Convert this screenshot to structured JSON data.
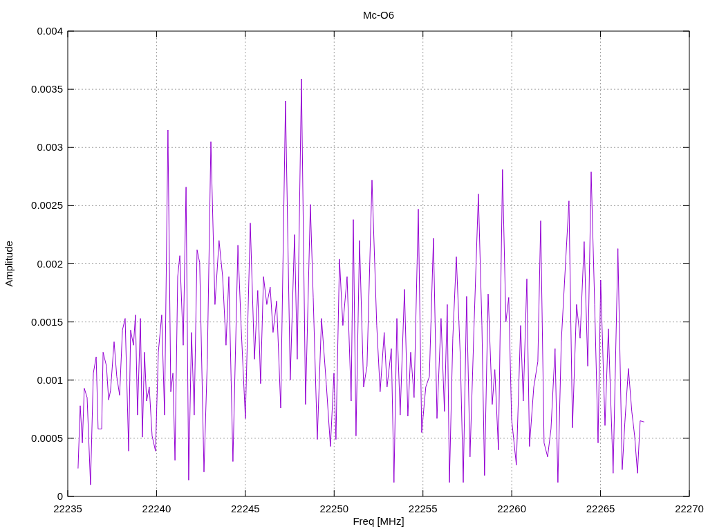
{
  "chart_data": {
    "type": "line",
    "grid": true,
    "title": "Mc-O6",
    "xlabel": "Freq [MHz]",
    "ylabel": "Amplitude",
    "xlim": [
      22235,
      22270
    ],
    "ylim": [
      0,
      0.004
    ],
    "xticks": [
      22235,
      22240,
      22245,
      22250,
      22255,
      22260,
      22265,
      22270
    ],
    "yticks": [
      0,
      0.0005,
      0.001,
      0.0015,
      0.002,
      0.0025,
      0.003,
      0.0035,
      0.004
    ],
    "x": [
      22235.58,
      22235.7,
      22235.82,
      22235.93,
      22236.09,
      22236.28,
      22236.44,
      22236.6,
      22236.71,
      22236.91,
      22236.99,
      22237.18,
      22237.3,
      22237.41,
      22237.61,
      22237.76,
      22237.92,
      22238.08,
      22238.23,
      22238.43,
      22238.54,
      22238.7,
      22238.81,
      22238.93,
      22239.09,
      22239.2,
      22239.32,
      22239.44,
      22239.59,
      22239.75,
      22239.94,
      22240.1,
      22240.29,
      22240.45,
      22240.64,
      22240.8,
      22240.92,
      22241.04,
      22241.19,
      22241.31,
      22241.5,
      22241.66,
      22241.81,
      22241.97,
      22242.12,
      22242.28,
      22242.43,
      22242.67,
      22242.86,
      22243.06,
      22243.29,
      22243.52,
      22243.72,
      22243.91,
      22244.07,
      22244.3,
      22244.58,
      22244.77,
      22245.0,
      22245.28,
      22245.51,
      22245.7,
      22245.86,
      22246.02,
      22246.21,
      22246.4,
      22246.56,
      22246.76,
      22246.99,
      22247.26,
      22247.53,
      22247.77,
      22247.92,
      22248.16,
      22248.39,
      22248.66,
      22248.82,
      22249.05,
      22249.29,
      22249.56,
      22249.79,
      22249.99,
      22250.1,
      22250.3,
      22250.49,
      22250.73,
      22250.96,
      22251.08,
      22251.23,
      22251.43,
      22251.66,
      22251.85,
      22252.13,
      22252.4,
      22252.59,
      22252.82,
      22252.98,
      22253.22,
      22253.37,
      22253.53,
      22253.72,
      22253.96,
      22254.15,
      22254.31,
      22254.5,
      22254.74,
      22254.93,
      22255.16,
      22255.36,
      22255.59,
      22255.79,
      22256.02,
      22256.21,
      22256.37,
      22256.49,
      22256.68,
      22256.88,
      22257.11,
      22257.27,
      22257.46,
      22257.65,
      22257.89,
      22258.12,
      22258.32,
      22258.47,
      22258.67,
      22258.9,
      22259.05,
      22259.25,
      22259.48,
      22259.67,
      22259.83,
      22259.99,
      22260.26,
      22260.5,
      22260.65,
      22260.85,
      22261.0,
      22261.24,
      22261.47,
      22261.63,
      22261.82,
      22262.02,
      22262.21,
      22262.44,
      22262.6,
      22262.79,
      22262.99,
      22263.22,
      22263.42,
      22263.65,
      22263.85,
      22264.08,
      22264.28,
      22264.47,
      22264.67,
      22264.86,
      22265.01,
      22265.25,
      22265.44,
      22265.71,
      22265.98,
      22266.22,
      22266.37,
      22266.57,
      22266.76,
      22266.92,
      22267.08,
      22267.23,
      22267.46
    ],
    "series": [
      {
        "color": "#9400d3",
        "values": [
          0.00024,
          0.00078,
          0.00046,
          0.00093,
          0.00085,
          0.0001,
          0.00106,
          0.0012,
          0.00058,
          0.00058,
          0.00124,
          0.00112,
          0.00083,
          0.00091,
          0.00133,
          0.00103,
          0.00087,
          0.00143,
          0.00153,
          0.00039,
          0.00143,
          0.0013,
          0.00156,
          0.0007,
          0.00153,
          0.00051,
          0.00124,
          0.00082,
          0.00094,
          0.00052,
          0.00039,
          0.00124,
          0.00156,
          0.0007,
          0.00315,
          0.0009,
          0.00106,
          0.00031,
          0.00189,
          0.00207,
          0.0013,
          0.00266,
          0.00014,
          0.00141,
          0.0007,
          0.00212,
          0.00201,
          0.00021,
          0.00118,
          0.00305,
          0.00165,
          0.0022,
          0.00189,
          0.0013,
          0.00189,
          0.0003,
          0.00216,
          0.00144,
          0.00067,
          0.00235,
          0.00118,
          0.00177,
          0.00097,
          0.00189,
          0.00165,
          0.0018,
          0.00141,
          0.00168,
          0.00076,
          0.0034,
          0.001,
          0.00225,
          0.00118,
          0.00359,
          0.00079,
          0.00251,
          0.00171,
          0.00049,
          0.00153,
          0.00096,
          0.00043,
          0.00106,
          0.00049,
          0.00204,
          0.00147,
          0.00189,
          0.00082,
          0.00238,
          0.00052,
          0.0022,
          0.00094,
          0.00112,
          0.00272,
          0.00147,
          0.0009,
          0.00141,
          0.00094,
          0.00127,
          0.00012,
          0.00153,
          0.0007,
          0.00178,
          0.00069,
          0.00124,
          0.00085,
          0.00247,
          0.00055,
          0.00094,
          0.00103,
          0.00222,
          0.00067,
          0.00153,
          0.00073,
          0.00165,
          0.00012,
          0.00136,
          0.00206,
          0.00118,
          0.00012,
          0.00172,
          0.00034,
          0.00152,
          0.0026,
          0.00147,
          0.00018,
          0.00174,
          0.00079,
          0.00109,
          0.0004,
          0.00281,
          0.0015,
          0.00171,
          0.00067,
          0.00027,
          0.00147,
          0.00082,
          0.00187,
          0.00043,
          0.00094,
          0.00116,
          0.00237,
          0.00046,
          0.00034,
          0.00058,
          0.00127,
          0.00012,
          0.00133,
          0.00189,
          0.00254,
          0.00059,
          0.00165,
          0.00136,
          0.00219,
          0.00112,
          0.00279,
          0.00165,
          0.00046,
          0.00186,
          0.00061,
          0.00144,
          0.0002,
          0.00213,
          0.00023,
          0.00064,
          0.0011,
          0.00073,
          0.00052,
          0.0002,
          0.00065,
          0.00064
        ]
      }
    ]
  }
}
